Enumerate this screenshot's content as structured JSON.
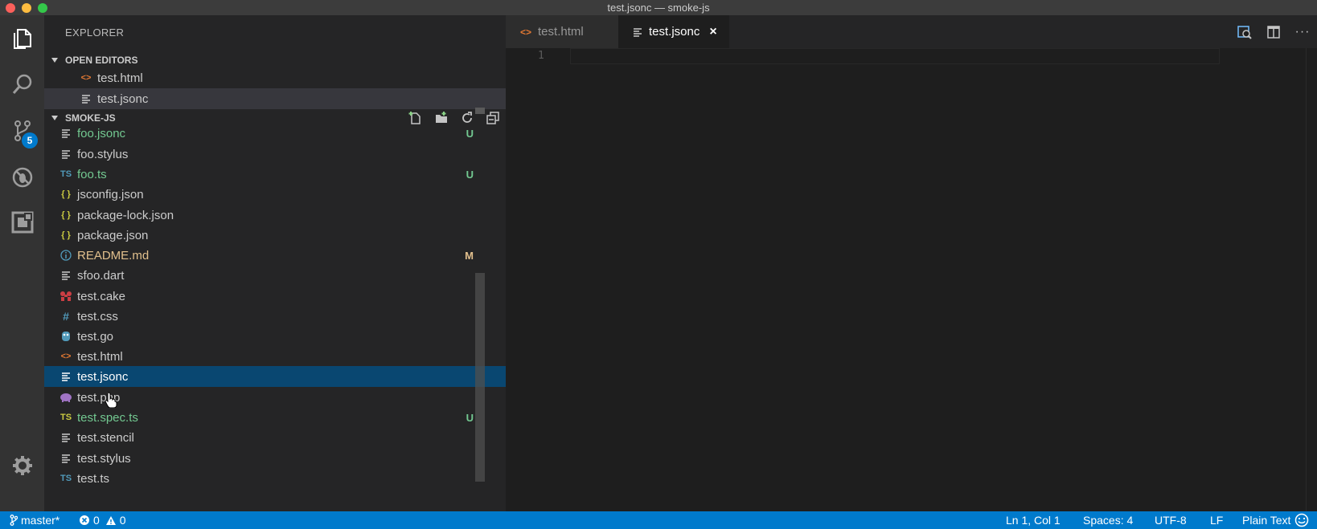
{
  "window": {
    "title": "test.jsonc — smoke-js"
  },
  "activity_bar": {
    "items": [
      {
        "name": "explorer-icon"
      },
      {
        "name": "search-icon"
      },
      {
        "name": "source-control-icon",
        "badge": "5"
      },
      {
        "name": "debug-icon"
      },
      {
        "name": "extensions-icon"
      }
    ],
    "settings_icon": "gear-icon"
  },
  "sidebar": {
    "title": "EXPLORER",
    "open_editors": {
      "header": "OPEN EDITORS",
      "items": [
        {
          "label": "test.html",
          "icon": "html-icon"
        },
        {
          "label": "test.jsonc",
          "icon": "lines-icon"
        }
      ]
    },
    "project": {
      "header": "SMOKE-JS",
      "items": [
        {
          "label": "foo.jsonc",
          "icon": "lines-icon",
          "status": "U",
          "color": "#73c991"
        },
        {
          "label": "foo.stylus",
          "icon": "lines-icon",
          "status": "",
          "color": "#cccccc"
        },
        {
          "label": "foo.ts",
          "icon": "ts-icon",
          "status": "U",
          "color": "#73c991"
        },
        {
          "label": "jsconfig.json",
          "icon": "json-icon",
          "status": "",
          "color": "#cccccc"
        },
        {
          "label": "package-lock.json",
          "icon": "json-icon",
          "status": "",
          "color": "#cccccc"
        },
        {
          "label": "package.json",
          "icon": "json-icon",
          "status": "",
          "color": "#cccccc"
        },
        {
          "label": "README.md",
          "icon": "info-icon",
          "status": "M",
          "color": "#e2c08d"
        },
        {
          "label": "sfoo.dart",
          "icon": "lines-icon",
          "status": "",
          "color": "#cccccc"
        },
        {
          "label": "test.cake",
          "icon": "cake-icon",
          "status": "",
          "color": "#cccccc"
        },
        {
          "label": "test.css",
          "icon": "hash-icon",
          "status": "",
          "color": "#cccccc"
        },
        {
          "label": "test.go",
          "icon": "go-icon",
          "status": "",
          "color": "#cccccc"
        },
        {
          "label": "test.html",
          "icon": "html-icon",
          "status": "",
          "color": "#cccccc"
        },
        {
          "label": "test.jsonc",
          "icon": "lines-icon",
          "status": "",
          "color": "#ffffff"
        },
        {
          "label": "test.php",
          "icon": "php-icon",
          "status": "",
          "color": "#cccccc"
        },
        {
          "label": "test.spec.ts",
          "icon": "ts-icon",
          "status": "U",
          "color": "#73c991"
        },
        {
          "label": "test.stencil",
          "icon": "lines-icon",
          "status": "",
          "color": "#cccccc"
        },
        {
          "label": "test.stylus",
          "icon": "lines-icon",
          "status": "",
          "color": "#cccccc"
        },
        {
          "label": "test.ts",
          "icon": "ts-icon",
          "status": "",
          "color": "#cccccc"
        }
      ]
    }
  },
  "editor": {
    "tabs": [
      {
        "label": "test.html",
        "icon": "html-icon",
        "active": false
      },
      {
        "label": "test.jsonc",
        "icon": "lines-icon",
        "active": true,
        "close": "×"
      }
    ],
    "line_numbers": [
      "1"
    ]
  },
  "status_bar": {
    "branch": "master*",
    "errors": "0",
    "warnings": "0",
    "position": "Ln 1, Col 1",
    "spaces": "Spaces: 4",
    "encoding": "UTF-8",
    "eol": "LF",
    "language": "Plain Text"
  },
  "colors": {
    "accent": "#007acc",
    "untracked": "#73c991",
    "modified": "#e2c08d",
    "selection": "#094771"
  }
}
